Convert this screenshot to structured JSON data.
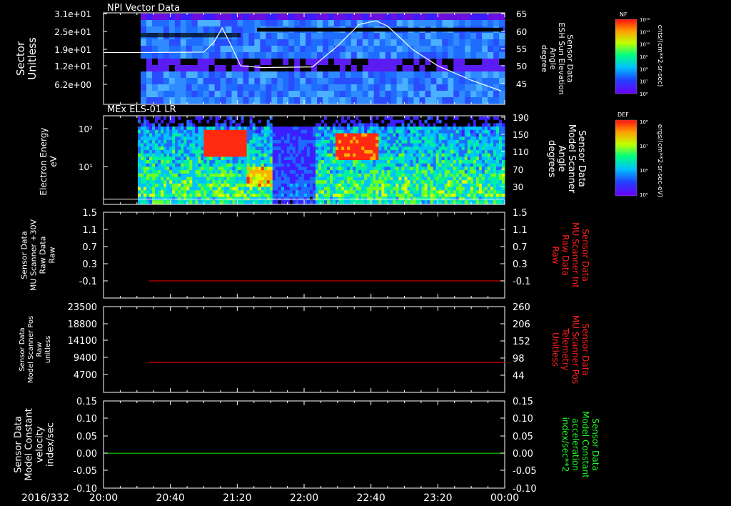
{
  "time_axis": {
    "date_label": "2016/332",
    "tick_labels": [
      "20:00",
      "20:40",
      "21:20",
      "22:00",
      "22:40",
      "23:20",
      "00:00"
    ]
  },
  "chart_data": [
    {
      "type": "heatmap",
      "title": "NPI Vector Data",
      "ylabel_left": [
        "Sector",
        "Unitless"
      ],
      "yticks_left": [
        "3.1e+01",
        "2.5e+01",
        "1.9e+01",
        "1.2e+01",
        "6.2e+00"
      ],
      "ylabel_right": [
        "Sensor Data",
        "ESH Sun Elevation",
        "Angle",
        "degree"
      ],
      "yticks_right": [
        "65",
        "60",
        "55",
        "50",
        "45"
      ],
      "right_ylim": [
        40,
        65
      ],
      "colorbar": {
        "label": "NF",
        "tick_labels": [
          "10¹²",
          "10¹¹",
          "10¹⁰",
          "10⁹",
          "10⁸",
          "10⁷",
          "10⁶"
        ],
        "units": "cnts/(cm**2-sr-sec)"
      },
      "line_series": {
        "color": "#ffffff",
        "x": [
          "20:00",
          "20:27",
          "21:00",
          "21:06",
          "21:11",
          "21:16",
          "21:22",
          "21:35",
          "22:05",
          "22:20",
          "22:33",
          "22:43",
          "22:50",
          "23:05",
          "23:20",
          "23:40",
          "23:58"
        ],
        "y": [
          54.2,
          54.2,
          54.3,
          57.0,
          61.0,
          56.5,
          50.5,
          50.0,
          50.2,
          56.0,
          62.0,
          63.0,
          61.5,
          55.0,
          50.5,
          46.5,
          43.5
        ]
      }
    },
    {
      "type": "heatmap",
      "title": "MEx ELS-01 LR",
      "ylabel_left": [
        "Electron Energy",
        "eV"
      ],
      "yticks_left": [
        "10²",
        "10¹"
      ],
      "ylabel_right": [
        "Sensor Data",
        "Model Scanner",
        "Angle",
        "degrees"
      ],
      "yticks_right": [
        "190",
        "150",
        "110",
        "70",
        "30"
      ],
      "right_ylim": [
        0,
        190
      ],
      "colorbar": {
        "label": "DEF",
        "tick_labels": [
          "10⁸",
          "10⁷",
          "10⁶",
          "10⁵"
        ],
        "units": "ergs/(cm**2-sr-sec-eV)"
      },
      "line_series": {
        "color": "#ffffff",
        "x": [
          "20:00",
          "00:00"
        ],
        "y": [
          10,
          10
        ]
      }
    },
    {
      "type": "line",
      "ylabel_left": [
        "Sensor Data",
        "MU Scanner +30V",
        "Raw Data",
        "Raw"
      ],
      "yticks_left": [
        "1.5",
        "1.1",
        "0.7",
        "0.3",
        "-0.1"
      ],
      "ylabel_right": [
        "Sensor Data",
        "MU Scanner Int",
        "Raw Data",
        "Raw"
      ],
      "yticks_right": [
        "1.5",
        "1.1",
        "0.7",
        "0.3",
        "-0.1"
      ],
      "right_label_color": "#ff2020",
      "ylim": [
        -0.5,
        1.5
      ],
      "series": [
        {
          "color": "#cc0000",
          "x": [
            "20:27",
            "00:00"
          ],
          "values": [
            -0.1,
            -0.1
          ]
        }
      ]
    },
    {
      "type": "line",
      "ylabel_left": [
        "Sensor Data",
        "Model Scanner Pos",
        "Raw",
        "unitless"
      ],
      "yticks_left": [
        "23500",
        "18800",
        "14100",
        "9400",
        "4700"
      ],
      "ylabel_right": [
        "Sensor Data",
        "MU Scanner Pos",
        "Telemetry",
        "Unitless"
      ],
      "yticks_right": [
        "260",
        "206",
        "152",
        "98",
        "44"
      ],
      "right_label_color": "#ff2020",
      "ylim": [
        0,
        23500
      ],
      "series": [
        {
          "color": "#cc0000",
          "x": [
            "20:27",
            "00:00"
          ],
          "values": [
            8200,
            8200
          ]
        }
      ]
    },
    {
      "type": "line",
      "ylabel_left": [
        "Sensor Data",
        "Model Constant",
        "velocity",
        "index/sec"
      ],
      "yticks_left": [
        "0.15",
        "0.10",
        "0.05",
        "0.00",
        "-0.05",
        "-0.10"
      ],
      "ylabel_right": [
        "Sensor Data",
        "Model Constant",
        "acceleration",
        "index/sec**2"
      ],
      "yticks_right": [
        "0.15",
        "0.10",
        "0.05",
        "0.00",
        "-0.05",
        "-0.10"
      ],
      "right_label_color": "#20ff20",
      "ylim": [
        -0.1,
        0.15
      ],
      "series": [
        {
          "color": "#00cc00",
          "x": [
            "20:00",
            "00:00"
          ],
          "values": [
            0.0,
            0.0
          ]
        }
      ]
    }
  ]
}
